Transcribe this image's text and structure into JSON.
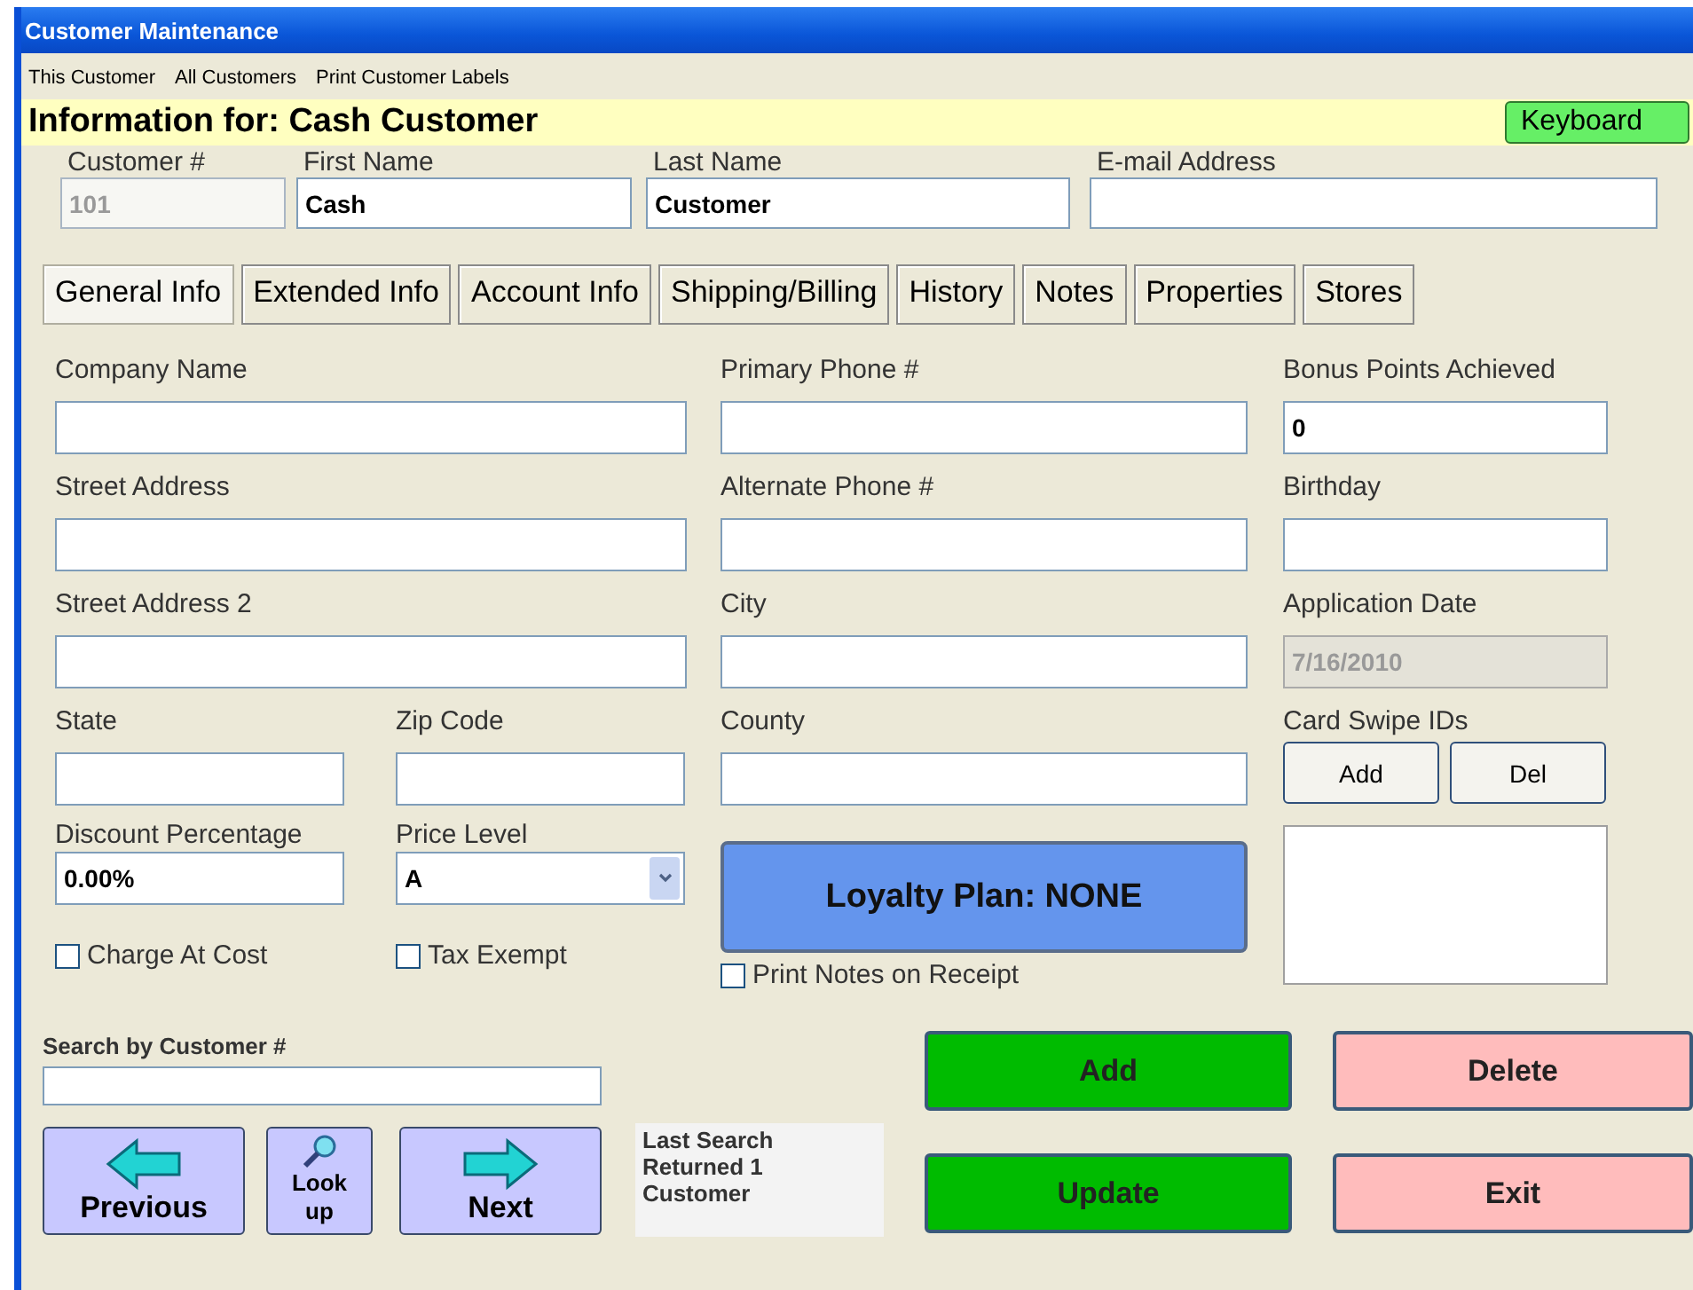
{
  "window": {
    "title": "Customer Maintenance"
  },
  "menu": [
    "This Customer",
    "All Customers",
    "Print Customer Labels"
  ],
  "header": {
    "title": "Information for: Cash Customer",
    "keyboard_button": "Keyboard"
  },
  "top_fields": [
    {
      "label": "Customer #",
      "value": "101",
      "disabled": true
    },
    {
      "label": "First Name",
      "value": "Cash",
      "disabled": false
    },
    {
      "label": "Last Name",
      "value": "Customer",
      "disabled": false
    },
    {
      "label": "E-mail Address",
      "disabled": false
    }
  ],
  "tabs": [
    {
      "label": "General Info",
      "selected": true
    },
    {
      "label": "Extended Info",
      "selected": false
    },
    {
      "label": "Account Info",
      "selected": false
    },
    {
      "label": "Shipping/Billing",
      "selected": false
    },
    {
      "label": "History",
      "selected": false
    },
    {
      "label": "Notes",
      "selected": false
    },
    {
      "label": "Properties",
      "selected": false
    },
    {
      "label": "Stores",
      "selected": false
    }
  ],
  "columns": [
    [
      {
        "kind": "field",
        "label": "Company Name",
        "disabled": false
      },
      {
        "kind": "field",
        "label": "Street Address",
        "disabled": false
      },
      {
        "kind": "field",
        "label": "Street Address 2",
        "disabled": false
      },
      {
        "kind": "pair",
        "items": [
          {
            "kind": "field",
            "label": "State",
            "disabled": false
          },
          {
            "kind": "field",
            "label": "Zip Code",
            "disabled": false
          }
        ]
      },
      {
        "kind": "pair",
        "items": [
          {
            "kind": "field",
            "label": "Discount Percentage",
            "value": "0.00%",
            "disabled": false
          },
          {
            "kind": "select",
            "label": "Price Level",
            "value": "A"
          }
        ]
      },
      {
        "kind": "pair",
        "items": [
          {
            "kind": "checkbox",
            "label": "Charge At Cost",
            "checked": false
          },
          {
            "kind": "checkbox",
            "label": "Tax Exempt",
            "checked": false
          }
        ]
      }
    ],
    [
      {
        "kind": "field",
        "label": "Primary Phone #",
        "disabled": false
      },
      {
        "kind": "field",
        "label": "Alternate Phone #",
        "disabled": false
      },
      {
        "kind": "field",
        "label": "City",
        "disabled": false
      },
      {
        "kind": "field",
        "label": "County",
        "disabled": false
      },
      {
        "kind": "plan",
        "label": "Loyalty Plan: NONE"
      },
      {
        "kind": "checkbox",
        "label": "Print Notes on Receipt",
        "checked": false
      }
    ],
    [
      {
        "kind": "field",
        "label": "Bonus Points Achieved",
        "value": "0",
        "disabled": false
      },
      {
        "kind": "field",
        "label": "Birthday",
        "disabled": false
      },
      {
        "kind": "field",
        "label": "Application Date",
        "value": "7/16/2010",
        "disabled": true
      },
      {
        "kind": "ids",
        "label": "Card Swipe IDs",
        "buttons": [
          "Add",
          "Del"
        ]
      },
      {
        "kind": "listbox"
      }
    ]
  ],
  "search": {
    "label": "Search by Customer #"
  },
  "nav_buttons": [
    {
      "kind": "previous",
      "label": "Previous"
    },
    {
      "kind": "lookup",
      "label": "Look up"
    },
    {
      "kind": "next",
      "label": "Next"
    }
  ],
  "last_search": "Last Search Returned 1 Customer",
  "actions": [
    {
      "kind": "go",
      "label": "Add"
    },
    {
      "kind": "stop",
      "label": "Delete"
    },
    {
      "kind": "go",
      "label": "Update"
    },
    {
      "kind": "stop",
      "label": "Exit"
    }
  ]
}
